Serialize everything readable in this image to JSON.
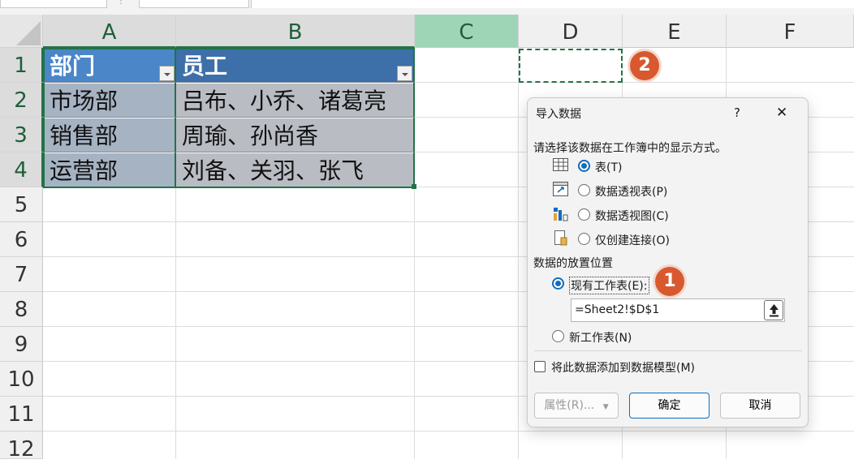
{
  "formula_bar": {
    "name_box": "",
    "formula": ""
  },
  "columns": [
    "A",
    "B",
    "C",
    "D",
    "E",
    "F"
  ],
  "rows": [
    "1",
    "2",
    "3",
    "4",
    "5",
    "6",
    "7",
    "8",
    "9",
    "10",
    "11",
    "12"
  ],
  "table": {
    "headers": [
      "部门",
      "员工"
    ],
    "rows": [
      [
        "市场部",
        "吕布、小乔、诸葛亮"
      ],
      [
        "销售部",
        "周瑜、孙尚香"
      ],
      [
        "运营部",
        "刘备、关羽、张飞"
      ]
    ]
  },
  "dialog": {
    "title": "导入数据",
    "help": "?",
    "close": "✕",
    "prompt": "请选择该数据在工作簿中的显示方式。",
    "display_options": [
      {
        "label": "表(T)",
        "icon": "table-icon",
        "selected": true
      },
      {
        "label": "数据透视表(P)",
        "icon": "pivot-table-icon",
        "selected": false
      },
      {
        "label": "数据透视图(C)",
        "icon": "pivot-chart-icon",
        "selected": false
      },
      {
        "label": "仅创建连接(O)",
        "icon": "connection-only-icon",
        "selected": false
      }
    ],
    "placement_label": "数据的放置位置",
    "existing_sheet": "现有工作表(E):",
    "existing_sheet_selected": true,
    "range_value": "=Sheet2!$D$1",
    "new_sheet": "新工作表(N)",
    "add_to_model": "将此数据添加到数据模型(M)",
    "add_to_model_checked": false,
    "properties_button": "属性(R)...",
    "ok_button": "确定",
    "cancel_button": "取消"
  },
  "annotations": {
    "badge1": "1",
    "badge2": "2"
  },
  "colors": {
    "accent": "#0f6cbd",
    "excel_green": "#217346",
    "badge": "#d8592f",
    "table_header": "#4a86c8"
  }
}
